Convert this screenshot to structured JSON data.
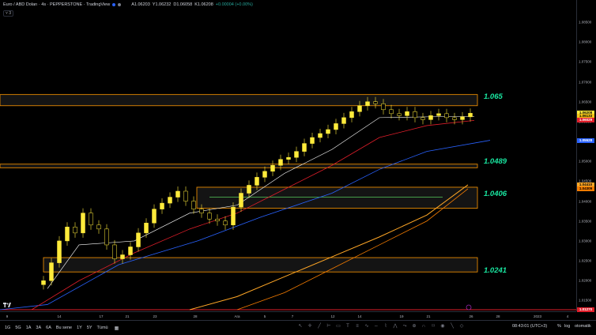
{
  "legend": {
    "title": "Euro / ABD Doları · 4s · PEPPERSTONE · TradingView",
    "open": "A1.06203",
    "high": "Y1.06232",
    "low": "D1.06058",
    "close": "K1.06208",
    "change": "+0.00004 (+0.00%)",
    "indicator_count": "3"
  },
  "price_axis": {
    "ticks": [
      "1.08500",
      "1.08000",
      "1.07500",
      "1.07000",
      "1.06500",
      "1.06000",
      "1.05500",
      "1.05000",
      "1.04500",
      "1.04000",
      "1.03500",
      "1.03000",
      "1.02500",
      "1.02000",
      "1.01500"
    ],
    "badges": [
      {
        "text": "1.06208",
        "bg": "#ffeb3b",
        "fg": "#000"
      },
      {
        "text": "1.06134",
        "bg": "#b2b5be",
        "fg": "#000"
      },
      {
        "text": "1.06133",
        "bg": "#f5c518",
        "fg": "#000"
      },
      {
        "text": "1.06029",
        "bg": "#e01e2a",
        "fg": "#fff"
      },
      {
        "text": "1.05528",
        "bg": "#2962ff",
        "fg": "#fff"
      },
      {
        "text": "1.04410",
        "bg": "#ffa726",
        "fg": "#000"
      },
      {
        "text": "1.04309",
        "bg": "#f57c00",
        "fg": "#000"
      },
      {
        "text": "1.01270",
        "bg": "#e01e2a",
        "fg": "#fff"
      }
    ]
  },
  "time_axis": {
    "ticks": [
      "9",
      "14",
      "17",
      "21",
      "23",
      "28",
      "Ara",
      "5",
      "7",
      "12",
      "14",
      "19",
      "21",
      "26",
      "28",
      "2023",
      "4"
    ]
  },
  "zones": [
    {
      "label": "1.065"
    },
    {
      "label": "1.0489"
    },
    {
      "label": "1.0406"
    },
    {
      "label": "1.0241"
    }
  ],
  "bottom": {
    "timeframes": [
      "1G",
      "5G",
      "1A",
      "3A",
      "6A",
      "Bu sene",
      "1Y",
      "5Y",
      "Tümü"
    ],
    "clock": "08:43:01 (UTC+3)",
    "percent": "%",
    "log": "log",
    "auto": "otomatik"
  },
  "colors": {
    "candle": "#ffeb3b",
    "ma_fast": "#ffffff",
    "ma_mid": "#e01e2a",
    "ma_slow": "#2962ff",
    "ma_200": "#ffa726",
    "zone_border": "#ff9800",
    "zone_label": "#19e6a0"
  },
  "chart_data": {
    "type": "candlestick",
    "series": [
      {
        "name": "EURUSD",
        "values": [
          1.02,
          1.0245,
          1.03,
          1.0335,
          1.032,
          1.037,
          1.034,
          1.033,
          1.029,
          1.0255,
          1.0265,
          1.0285,
          1.032,
          1.0345,
          1.038,
          1.0395,
          1.041,
          1.0425,
          1.04,
          1.038,
          1.037,
          1.0355,
          1.035,
          1.034,
          1.0385,
          1.042,
          1.044,
          1.046,
          1.0475,
          1.049,
          1.0505,
          1.051,
          1.0525,
          1.0545,
          1.056,
          1.057,
          1.058,
          1.0595,
          1.061,
          1.0625,
          1.064,
          1.065,
          1.0645,
          1.063,
          1.062,
          1.0615,
          1.0625,
          1.061,
          1.0605,
          1.0615,
          1.062,
          1.061,
          1.0605,
          1.0612,
          1.0621
        ]
      }
    ],
    "ylim": [
      1.0127,
      1.087
    ]
  }
}
